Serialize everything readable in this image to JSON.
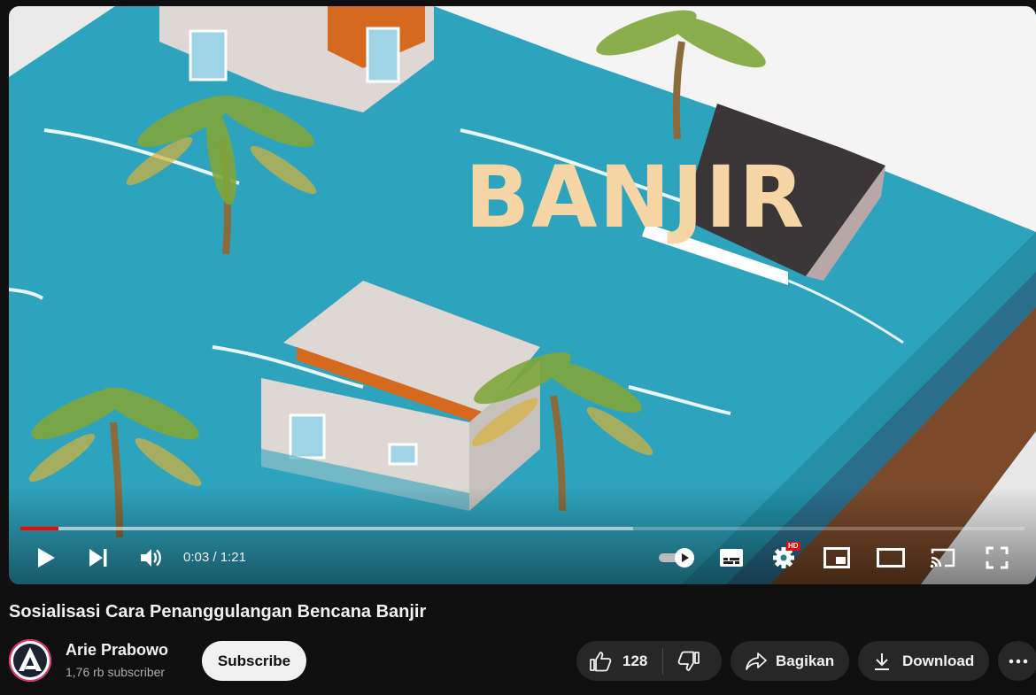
{
  "video": {
    "overlay_title": "BANJIR",
    "time_current": "0:03",
    "time_separator": " / ",
    "time_total": "1:21",
    "progress_fraction": 0.038,
    "buffered_fraction": 0.61,
    "hd_badge": "HD"
  },
  "title": "Sosialisasi Cara Penanggulangan Bencana Banjir",
  "channel": {
    "name": "Arie Prabowo",
    "subscribers": "1,76 rb subscriber",
    "subscribe_label": "Subscribe"
  },
  "actions": {
    "like_count": "128",
    "share_label": "Bagikan",
    "download_label": "Download"
  },
  "icons": [
    "play-icon",
    "next-icon",
    "volume-icon",
    "autoplay-toggle-icon",
    "subtitles-icon",
    "settings-icon",
    "miniplayer-icon",
    "theater-icon",
    "cast-icon",
    "fullscreen-icon",
    "like-icon",
    "dislike-icon",
    "share-icon",
    "download-icon",
    "more-icon"
  ],
  "colors": {
    "accent_red": "#ff0000",
    "title_text": "#f7d6a6",
    "water": "#2ea3bd"
  }
}
